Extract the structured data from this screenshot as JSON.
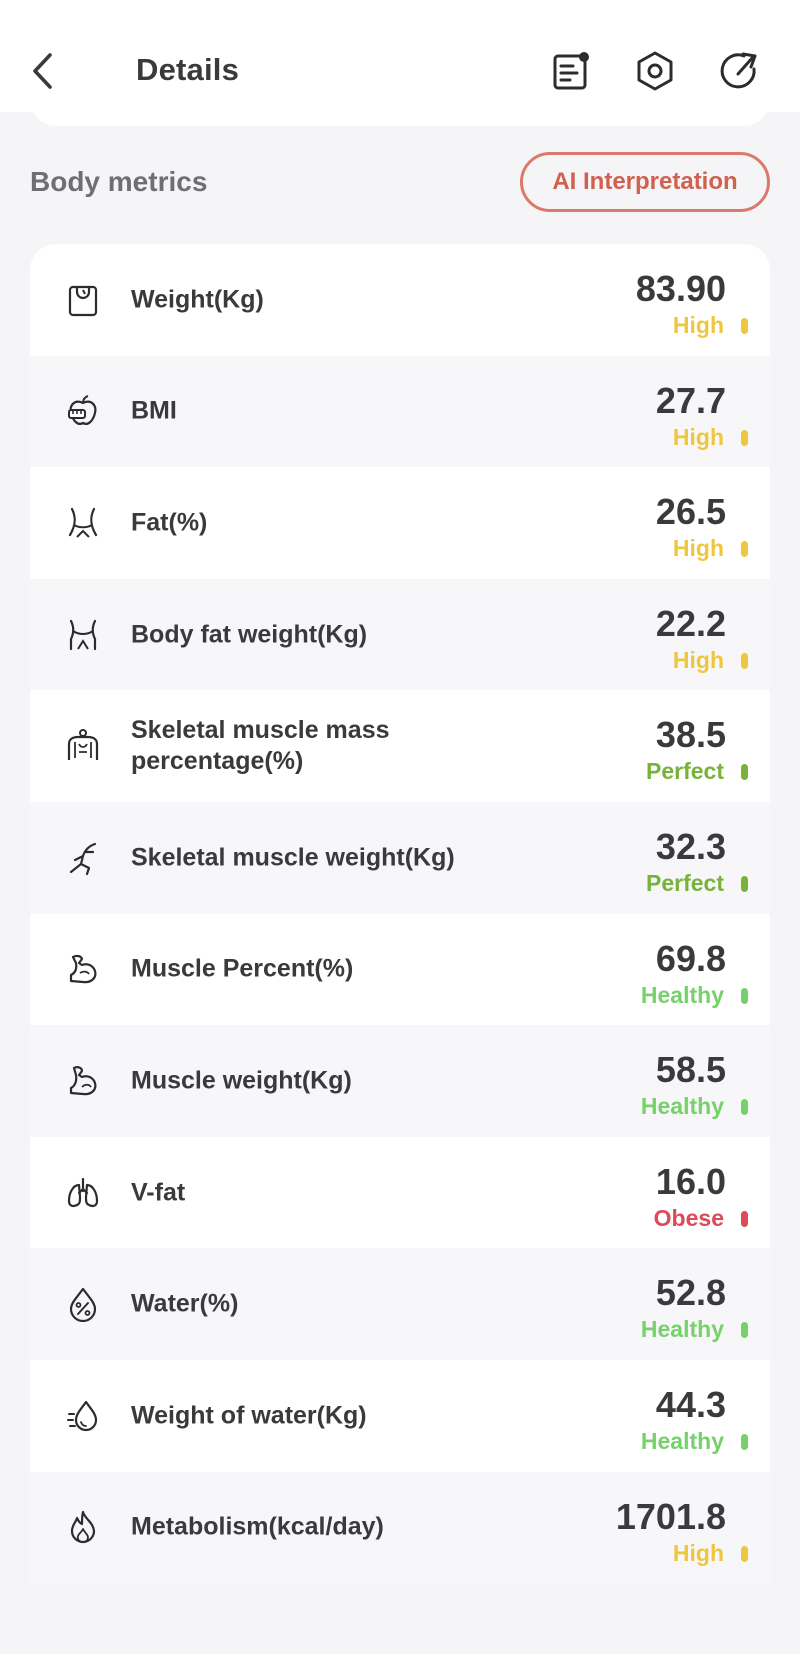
{
  "header": {
    "title": "Details"
  },
  "section": {
    "title": "Body metrics",
    "ai_button": "AI Interpretation"
  },
  "colors": {
    "high": "#eec63f",
    "perfect": "#77b23a",
    "healthy": "#77d16a",
    "obese": "#dd4a5a",
    "accent": "#d97a6a"
  },
  "metrics": [
    {
      "icon": "scale-icon",
      "label": "Weight(Kg)",
      "value": "83.90",
      "status": "High",
      "level": "high"
    },
    {
      "icon": "apple-tape-icon",
      "label": "BMI",
      "value": "27.7",
      "status": "High",
      "level": "high"
    },
    {
      "icon": "waist-icon",
      "label": "Fat(%)",
      "value": "26.5",
      "status": "High",
      "level": "high"
    },
    {
      "icon": "hips-icon",
      "label": "Body fat weight(Kg)",
      "value": "22.2",
      "status": "High",
      "level": "high"
    },
    {
      "icon": "torso-icon",
      "label": "Skeletal muscle mass percentage(%)",
      "value": "38.5",
      "status": "Perfect",
      "level": "perfect"
    },
    {
      "icon": "runner-icon",
      "label": "Skeletal muscle weight(Kg)",
      "value": "32.3",
      "status": "Perfect",
      "level": "perfect"
    },
    {
      "icon": "bicep-icon",
      "label": "Muscle Percent(%)",
      "value": "69.8",
      "status": "Healthy",
      "level": "healthy"
    },
    {
      "icon": "bicep-outline-icon",
      "label": "Muscle weight(Kg)",
      "value": "58.5",
      "status": "Healthy",
      "level": "healthy"
    },
    {
      "icon": "lungs-icon",
      "label": "V-fat",
      "value": "16.0",
      "status": "Obese",
      "level": "obese"
    },
    {
      "icon": "water-percent-icon",
      "label": "Water(%)",
      "value": "52.8",
      "status": "Healthy",
      "level": "healthy"
    },
    {
      "icon": "water-drop-icon",
      "label": "Weight of water(Kg)",
      "value": "44.3",
      "status": "Healthy",
      "level": "healthy"
    },
    {
      "icon": "flame-icon",
      "label": "Metabolism(kcal/day)",
      "value": "1701.8",
      "status": "High",
      "level": "high"
    }
  ]
}
